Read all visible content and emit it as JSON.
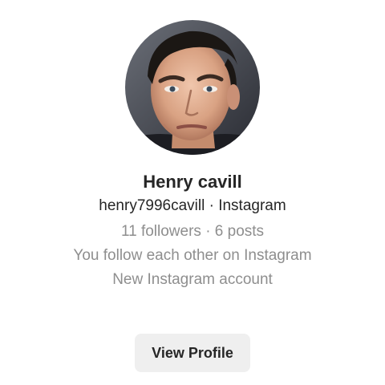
{
  "profile": {
    "name": "Henry cavill",
    "handle_line": "henry7996cavill · Instagram",
    "stats": "11 followers · 6 posts",
    "relationship": "You follow each other on Instagram",
    "account_note": "New Instagram account",
    "avatar_icon": "profile-photo"
  },
  "actions": {
    "view_profile_label": "View Profile"
  },
  "colors": {
    "primary_text": "#262626",
    "secondary_text": "#8e8e8e",
    "button_bg": "#efefef"
  }
}
